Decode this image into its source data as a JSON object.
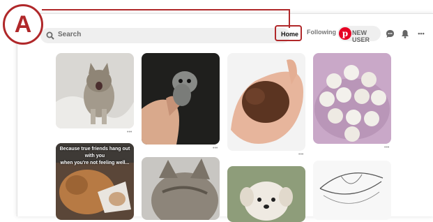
{
  "callout": {
    "letter": "A"
  },
  "search": {
    "label": "Search"
  },
  "nav": {
    "home": "Home",
    "following": "Following",
    "user": "NEW USER",
    "more": "•••"
  },
  "pins": [
    {
      "dots": "•••"
    },
    {
      "dots": "•••"
    },
    {
      "dots": "•••"
    },
    {
      "dots": "•••"
    }
  ],
  "caption": {
    "line1": "Because true friends hang out with you",
    "line2": "when you're not feeling well..."
  },
  "colors": {
    "callout": "#b0282a",
    "brand": "#e60023"
  }
}
